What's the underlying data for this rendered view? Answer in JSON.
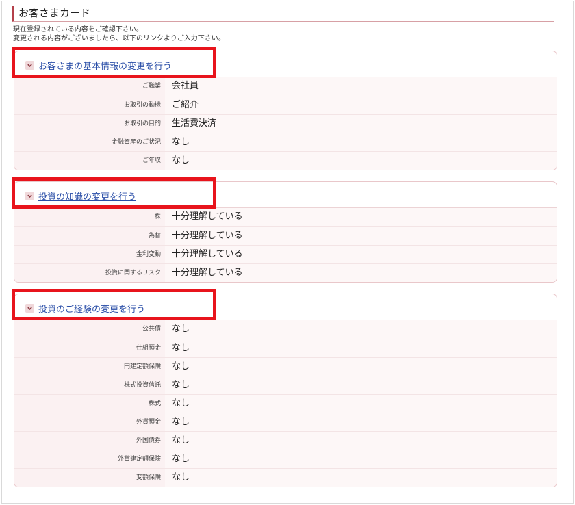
{
  "page": {
    "title": "お客さまカード",
    "intro_line1": "現在登録されている内容をご確認下さい。",
    "intro_line2": "変更される内容がございましたら、以下のリンクよりご入力下さい。"
  },
  "accent_color": "#e8141c",
  "link_color": "#2b4fa8",
  "sections": [
    {
      "heading": "お客さまの基本情報の変更を行う",
      "rows": [
        {
          "label": "ご職業",
          "value": "会社員"
        },
        {
          "label": "お取引の動機",
          "value": "ご紹介"
        },
        {
          "label": "お取引の目的",
          "value": "生活費決済"
        },
        {
          "label": "金融資産のご状況",
          "value": "なし"
        },
        {
          "label": "ご年収",
          "value": "なし"
        }
      ]
    },
    {
      "heading": "投資の知識の変更を行う",
      "rows": [
        {
          "label": "株",
          "value": "十分理解している"
        },
        {
          "label": "為替",
          "value": "十分理解している"
        },
        {
          "label": "金利変動",
          "value": "十分理解している"
        },
        {
          "label": "投資に関するリスク",
          "value": "十分理解している"
        }
      ]
    },
    {
      "heading": "投資のご経験の変更を行う",
      "rows": [
        {
          "label": "公共債",
          "value": "なし"
        },
        {
          "label": "仕組預金",
          "value": "なし"
        },
        {
          "label": "円建定額保険",
          "value": "なし"
        },
        {
          "label": "株式投資信託",
          "value": "なし"
        },
        {
          "label": "株式",
          "value": "なし"
        },
        {
          "label": "外貨預金",
          "value": "なし"
        },
        {
          "label": "外国債券",
          "value": "なし"
        },
        {
          "label": "外貨建定額保険",
          "value": "なし"
        },
        {
          "label": "変額保険",
          "value": "なし"
        }
      ]
    }
  ]
}
